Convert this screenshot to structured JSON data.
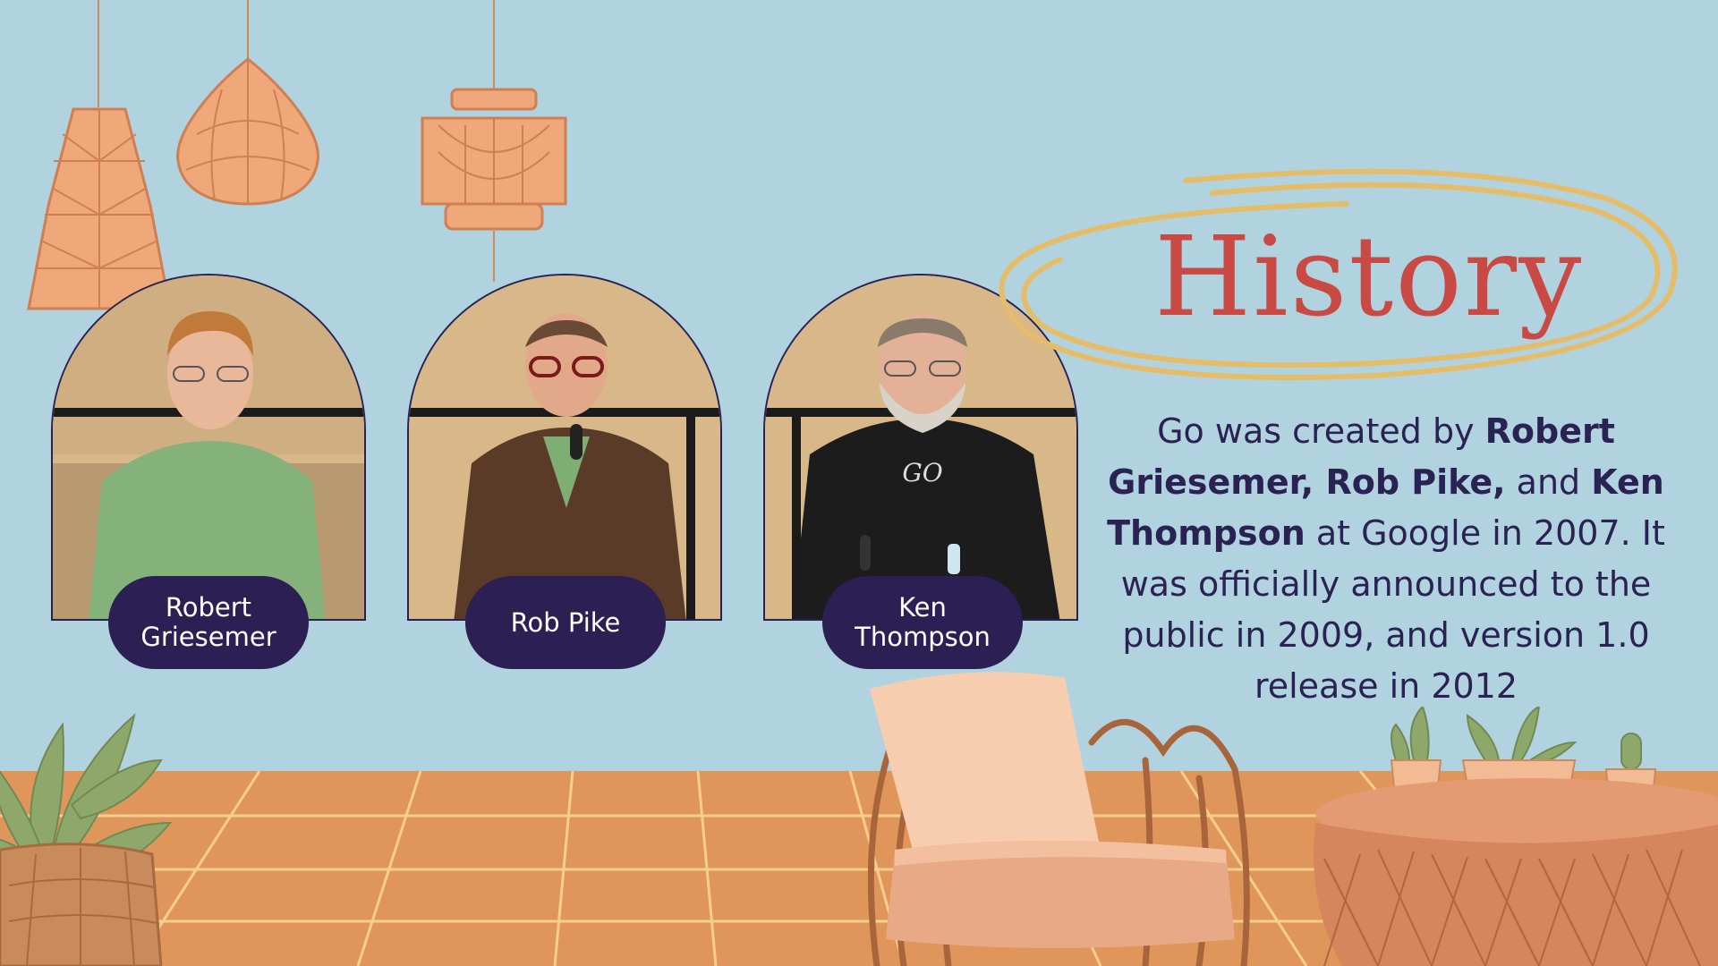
{
  "slide": {
    "title": "History",
    "people": [
      {
        "name": "Robert Griesemer"
      },
      {
        "name": "Rob Pike"
      },
      {
        "name": "Ken Thompson"
      }
    ],
    "body": {
      "t1": "Go was created by ",
      "b1": "Robert Griesemer, Rob Pike,",
      "t2": " and ",
      "b2": "Ken Thompson",
      "t3": " at Google in 2007. It was officially announced to the public in 2009, and version 1.0 release in 2012"
    }
  },
  "colors": {
    "background": "#b1d3df",
    "pill": "#2b1f54",
    "title": "#c94a44",
    "text": "#2b2254",
    "floor": "#e0965a"
  }
}
